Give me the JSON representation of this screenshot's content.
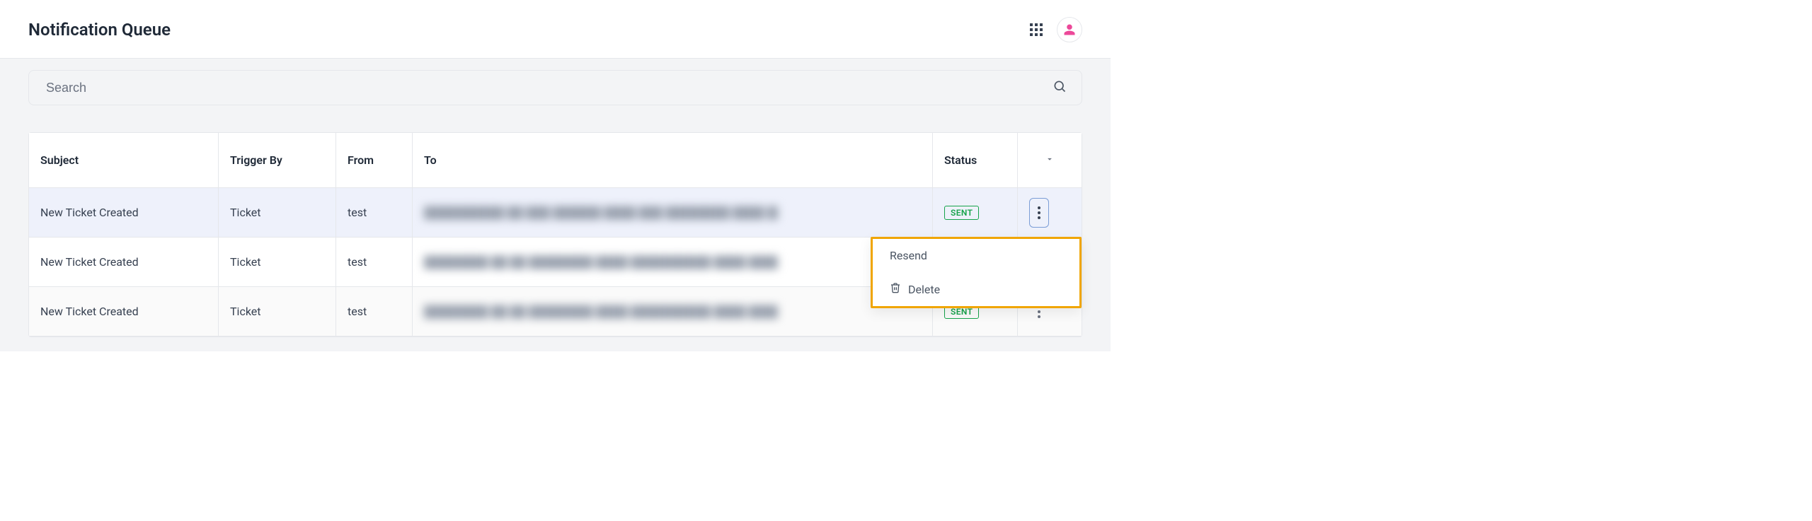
{
  "header": {
    "title": "Notification Queue"
  },
  "search": {
    "placeholder": "Search",
    "value": ""
  },
  "table": {
    "columns": {
      "subject": "Subject",
      "trigger_by": "Trigger By",
      "from": "From",
      "to": "To",
      "status": "Status"
    },
    "rows": [
      {
        "subject": "New Ticket Created",
        "trigger_by": "Ticket",
        "from": "test",
        "to": "",
        "status": "SENT"
      },
      {
        "subject": "New Ticket Created",
        "trigger_by": "Ticket",
        "from": "test",
        "to": "",
        "status": ""
      },
      {
        "subject": "New Ticket Created",
        "trigger_by": "Ticket",
        "from": "test",
        "to": "",
        "status": "SENT"
      }
    ]
  },
  "dropdown": {
    "resend": "Resend",
    "delete": "Delete"
  }
}
